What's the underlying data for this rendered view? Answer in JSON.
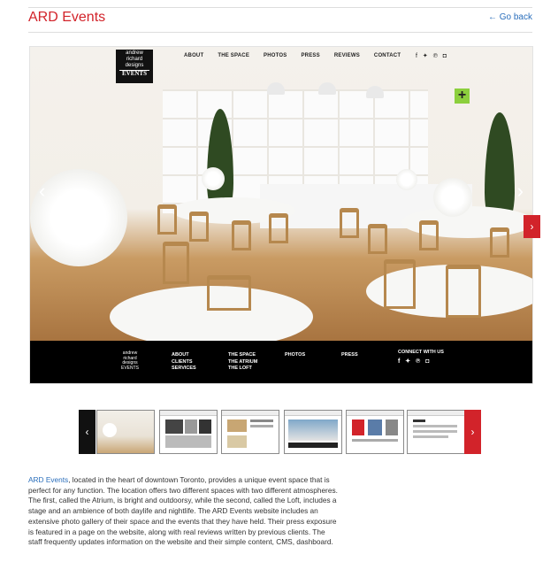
{
  "header": {
    "title": "ARD Events",
    "back_link": "← Go back"
  },
  "slide": {
    "logo": {
      "line1": "andrew",
      "line2": "richard",
      "line3": "designs",
      "line4": "EVENTS"
    },
    "nav": [
      "ABOUT",
      "THE SPACE",
      "PHOTOS",
      "PRESS",
      "REVIEWS",
      "CONTACT"
    ],
    "social": "f ✦ ℗ ◘",
    "plus": "+",
    "prev_arrow": "‹",
    "next_arrow": "›",
    "footer": {
      "col1": [
        "ABOUT",
        "CLIENTS",
        "SERVICES"
      ],
      "col2": [
        "THE SPACE",
        "THE ATRIUM",
        "THE LOFT"
      ],
      "col3": [
        "PHOTOS"
      ],
      "col4": [
        "PRESS"
      ],
      "col5_title": "CONNECT WITH US",
      "col5_social": "f ✦ ℗ ◘"
    }
  },
  "side_next": "›",
  "thumbs": {
    "prev": "‹",
    "next": "›",
    "count": 6
  },
  "description": {
    "link": "ARD Events",
    "text": ", located in the heart of downtown Toronto, provides a unique event space that is perfect for any function. The location offers two different spaces with two different atmospheres. The first, called the Atrium, is bright and outdoorsy, while the second, called the Loft, includes a stage and an ambience of both daylife and nightlife. The ARD Events website includes an extensive photo gallery of their space and the events that they have held. Their press exposure is featured in a page on the website, along with real reviews written by previous clients.  The staff frequently updates information on the website and their simple content, CMS, dashboard."
  },
  "colors": {
    "accent": "#d2232a",
    "link": "#2a6ebb"
  }
}
